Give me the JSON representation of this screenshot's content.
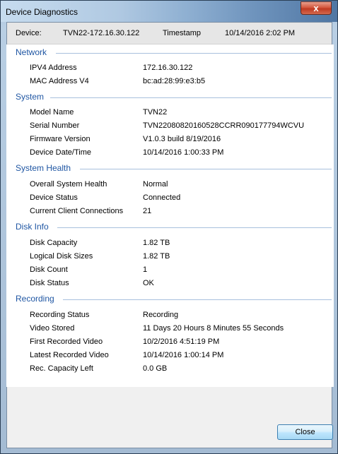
{
  "window": {
    "title": "Device Diagnostics",
    "close_glyph": "x"
  },
  "header": {
    "device_label": "Device:",
    "device_value": "TVN22-172.16.30.122",
    "timestamp_label": "Timestamp",
    "timestamp_value": "10/14/2016 2:02 PM"
  },
  "sections": [
    {
      "title": "Network",
      "rows": [
        {
          "label": "IPV4 Address",
          "value": "172.16.30.122"
        },
        {
          "label": "MAC Address V4",
          "value": "bc:ad:28:99:e3:b5"
        }
      ]
    },
    {
      "title": "System",
      "rows": [
        {
          "label": "Model Name",
          "value": "TVN22"
        },
        {
          "label": "Serial Number",
          "value": "TVN22080820160528CCRR090177794WCVU"
        },
        {
          "label": "Firmware Version",
          "value": "V1.0.3 build 8/19/2016"
        },
        {
          "label": "Device Date/Time",
          "value": "10/14/2016 1:00:33 PM"
        }
      ]
    },
    {
      "title": "System Health",
      "rows": [
        {
          "label": "Overall System Health",
          "value": "Normal"
        },
        {
          "label": "Device Status",
          "value": "Connected"
        },
        {
          "label": "Current Client Connections",
          "value": "21"
        }
      ]
    },
    {
      "title": "Disk Info",
      "rows": [
        {
          "label": "Disk Capacity",
          "value": "1.82 TB"
        },
        {
          "label": "Logical Disk Sizes",
          "value": "1.82 TB"
        },
        {
          "label": "Disk Count",
          "value": "1"
        },
        {
          "label": "Disk Status",
          "value": "OK"
        }
      ]
    },
    {
      "title": "Recording",
      "rows": [
        {
          "label": "Recording Status",
          "value": "Recording"
        },
        {
          "label": "Video Stored",
          "value": "11 Days 20 Hours 8 Minutes 55 Seconds"
        },
        {
          "label": "First Recorded Video",
          "value": "10/2/2016 4:51:19 PM"
        },
        {
          "label": "Latest Recorded Video",
          "value": "10/14/2016 1:00:14 PM"
        },
        {
          "label": "Rec. Capacity Left",
          "value": "0.0 GB"
        }
      ]
    }
  ],
  "footer": {
    "close_label": "Close"
  }
}
